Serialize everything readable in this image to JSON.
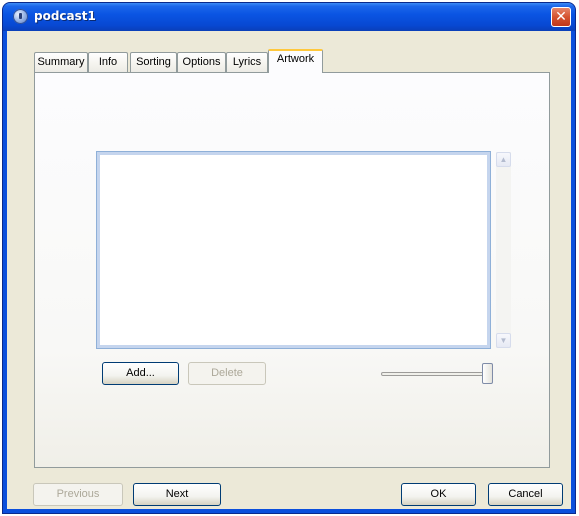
{
  "window": {
    "title": "podcast1",
    "close_symbol": "✕"
  },
  "tabs": [
    {
      "label": "Summary",
      "active": false
    },
    {
      "label": "Info",
      "active": false
    },
    {
      "label": "Sorting",
      "active": false
    },
    {
      "label": "Options",
      "active": false
    },
    {
      "label": "Lyrics",
      "active": false
    },
    {
      "label": "Artwork",
      "active": true
    }
  ],
  "artwork": {
    "add_label": "Add...",
    "delete_label": "Delete",
    "zoom_slider_value": 1.0
  },
  "footer": {
    "previous_label": "Previous",
    "next_label": "Next",
    "ok_label": "OK",
    "cancel_label": "Cancel"
  },
  "icons": {
    "app": "podcast-app-icon",
    "close": "close-icon",
    "scroll_up": "scroll-up-arrow-icon",
    "scroll_down": "scroll-down-arrow-icon"
  },
  "colors": {
    "titlebar": "#0a55e3",
    "active_tab_highlight": "#ffc83c",
    "close_button": "#d5532f"
  }
}
